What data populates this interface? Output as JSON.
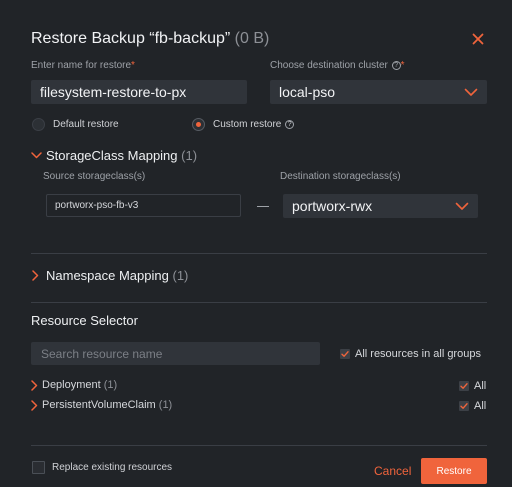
{
  "dialog": {
    "title": "Restore Backup “fb-backup”",
    "title_size": "(0 B)"
  },
  "restore_name": {
    "label": "Enter name for restore",
    "required_mark": "*",
    "value": "filesystem-restore-to-px"
  },
  "destination_cluster": {
    "label": "Choose destination cluster",
    "help_glyph": "?",
    "required_mark": "*",
    "value": "local-pso"
  },
  "restore_mode": {
    "options": [
      {
        "label": "Default restore",
        "selected": false
      },
      {
        "label": "Custom restore",
        "selected": true
      }
    ]
  },
  "storageclass_mapping": {
    "title": "StorageClass Mapping",
    "count": "(1)",
    "source_label": "Source storageclass(s)",
    "destination_label": "Destination storageclass(s)",
    "source_value": "portworx-pso-fb-v3",
    "destination_value": "portworx-rwx"
  },
  "namespace_mapping": {
    "title": "Namespace Mapping",
    "count": "(1)"
  },
  "resource_selector": {
    "title": "Resource Selector",
    "search_placeholder": "Search resource name",
    "all_groups_label": "All resources in all groups",
    "all_groups_checked": true,
    "groups": [
      {
        "name": "Deployment",
        "count": "(1)",
        "all_label": "All",
        "checked": true
      },
      {
        "name": "PersistentVolumeClaim",
        "count": "(1)",
        "all_label": "All",
        "checked": true
      }
    ]
  },
  "footer": {
    "replace_label": "Replace existing resources",
    "replace_checked": false,
    "cancel_label": "Cancel",
    "restore_label": "Restore"
  },
  "colors": {
    "accent": "#f0643c",
    "background": "#212428",
    "field": "#30343a"
  }
}
